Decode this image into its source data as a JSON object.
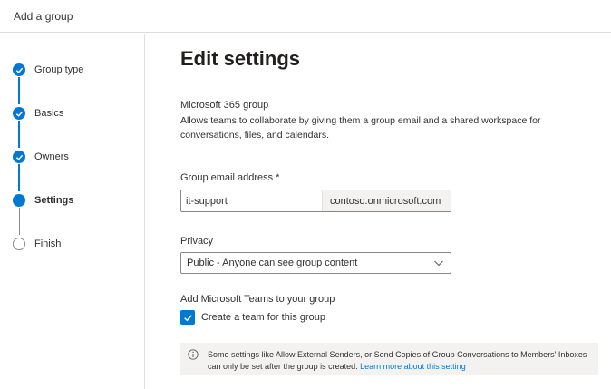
{
  "window": {
    "title": "Add a group"
  },
  "steps": [
    {
      "label": "Group type",
      "state": "done"
    },
    {
      "label": "Basics",
      "state": "done"
    },
    {
      "label": "Owners",
      "state": "done"
    },
    {
      "label": "Settings",
      "state": "current"
    },
    {
      "label": "Finish",
      "state": "todo"
    }
  ],
  "main": {
    "heading": "Edit settings",
    "group_type_title": "Microsoft 365 group",
    "group_type_desc": "Allows teams to collaborate by giving them a group email and a shared workspace for conversations, files, and calendars.",
    "email": {
      "label": "Group email address *",
      "value": "it-support",
      "domain": "contoso.onmicrosoft.com"
    },
    "privacy": {
      "label": "Privacy",
      "selected": "Public - Anyone can see group content"
    },
    "teams": {
      "label": "Add Microsoft Teams to your group",
      "checkbox_label": "Create a team for this group",
      "checked": true
    },
    "info": {
      "text": "Some settings like Allow External Senders, or Send Copies of Group Conversations to Members' Inboxes can only be set after the group is created.",
      "link": "Learn more about this setting"
    }
  },
  "colors": {
    "accent": "#0078d4",
    "info_bg": "#f3f2f1"
  }
}
